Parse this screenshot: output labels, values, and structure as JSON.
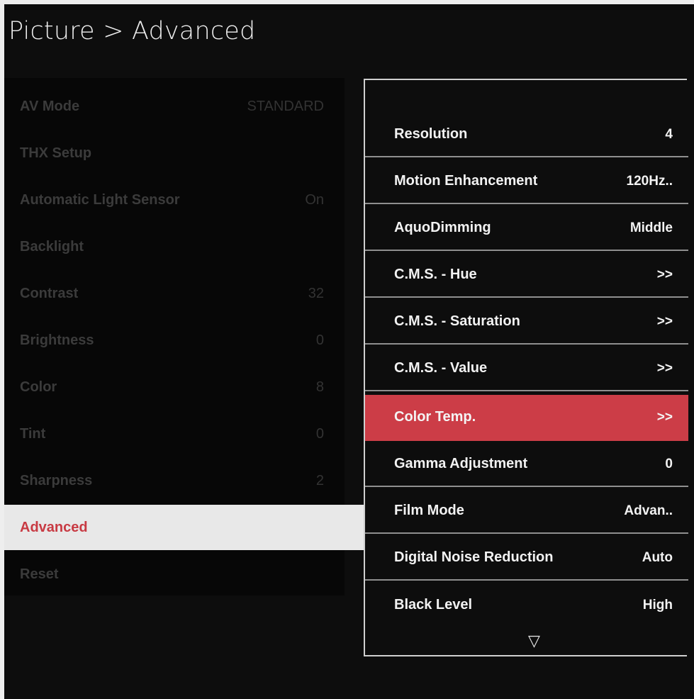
{
  "header": {
    "title": "Picture > Advanced"
  },
  "left_menu": {
    "items": [
      {
        "label": "AV Mode",
        "value": "STANDARD"
      },
      {
        "label": "THX Setup",
        "value": ""
      },
      {
        "label": "Automatic Light Sensor",
        "value": "On"
      },
      {
        "label": "Backlight",
        "value": ""
      },
      {
        "label": "Contrast",
        "value": "32"
      },
      {
        "label": "Brightness",
        "value": "0"
      },
      {
        "label": "Color",
        "value": "8"
      },
      {
        "label": "Tint",
        "value": "0"
      },
      {
        "label": "Sharpness",
        "value": "2"
      },
      {
        "label": "Advanced",
        "value": ""
      },
      {
        "label": "Reset",
        "value": ""
      }
    ],
    "selected_index": 9
  },
  "advanced_menu": {
    "items": [
      {
        "label": "Resolution",
        "value": "4"
      },
      {
        "label": "Motion Enhancement",
        "value": "120Hz.."
      },
      {
        "label": "AquoDimming",
        "value": "Middle"
      },
      {
        "label": "C.M.S. - Hue",
        "value": ">>"
      },
      {
        "label": "C.M.S. - Saturation",
        "value": ">>"
      },
      {
        "label": "C.M.S. - Value",
        "value": ">>"
      },
      {
        "label": "Color Temp.",
        "value": ">>"
      },
      {
        "label": "Gamma Adjustment",
        "value": "0"
      },
      {
        "label": "Film Mode",
        "value": "Advan.."
      },
      {
        "label": "Digital Noise Reduction",
        "value": "Auto"
      },
      {
        "label": "Black Level",
        "value": "High"
      }
    ],
    "highlighted_index": 6,
    "scroll_down_icon": "▽"
  },
  "colors": {
    "highlight": "#cc3d47",
    "selected_text": "#c83a43",
    "background": "#0d0d0d"
  }
}
